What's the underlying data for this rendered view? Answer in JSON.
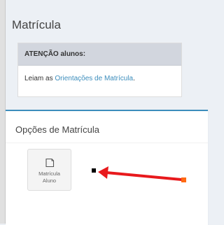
{
  "page": {
    "title": "Matrícula"
  },
  "notice": {
    "heading": "ATENÇÃO alunos:",
    "text_prefix": "Leiam as ",
    "link_text": "Orientações de Matrícula",
    "text_suffix": "."
  },
  "enrollment_panel": {
    "title": "Opções de Matrícula",
    "options": [
      {
        "label": "Matrícula\nAluno",
        "icon": "edit-square-icon"
      }
    ]
  },
  "colors": {
    "accent": "#3c8dbc",
    "annotation_arrow": "#e8191c",
    "annotation_start_marker": "#ff6a13",
    "annotation_end_marker": "#000000"
  }
}
